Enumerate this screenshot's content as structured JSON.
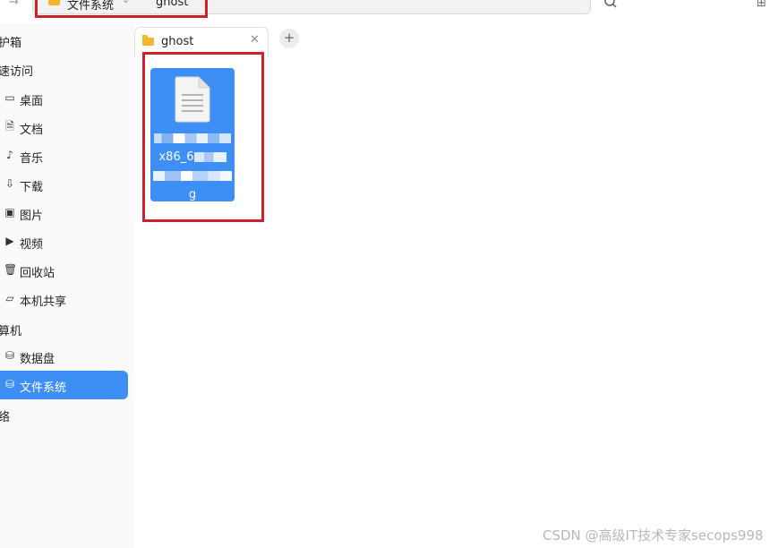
{
  "topbar": {
    "breadcrumb": [
      {
        "label": "文件系统",
        "icon": "folder-icon"
      },
      {
        "label": "ghost"
      }
    ],
    "forward_icon": "arrow-right-icon",
    "search_icon": "search-icon",
    "view_icon": "grid-view-icon"
  },
  "sidebar": {
    "sections": [
      "护箱",
      "速访问",
      "算机",
      "络"
    ],
    "items": [
      {
        "label": "桌面",
        "icon": "desktop-icon"
      },
      {
        "label": "文档",
        "icon": "document-icon"
      },
      {
        "label": "音乐",
        "icon": "music-icon"
      },
      {
        "label": "下载",
        "icon": "download-icon"
      },
      {
        "label": "图片",
        "icon": "picture-icon"
      },
      {
        "label": "视频",
        "icon": "video-icon"
      },
      {
        "label": "回收站",
        "icon": "trash-icon"
      },
      {
        "label": "本机共享",
        "icon": "folder-icon"
      },
      {
        "label": "数据盘",
        "icon": "drive-icon"
      },
      {
        "label": "文件系统",
        "icon": "drive-icon",
        "active": true
      }
    ]
  },
  "tabs": [
    {
      "label": "ghost",
      "icon": "folder-icon",
      "close_icon": "close-icon"
    }
  ],
  "add_tab_label": "+",
  "files": [
    {
      "name_visible": [
        "x86_6",
        "g"
      ],
      "icon": "document-file-icon",
      "selected": true,
      "name_partially_obscured": true
    }
  ],
  "colors": {
    "accent": "#3d8ff5",
    "highlight_box": "#d0202a",
    "folder": "#f6b62b"
  },
  "watermark": "CSDN @高级IT技术专家secops998"
}
